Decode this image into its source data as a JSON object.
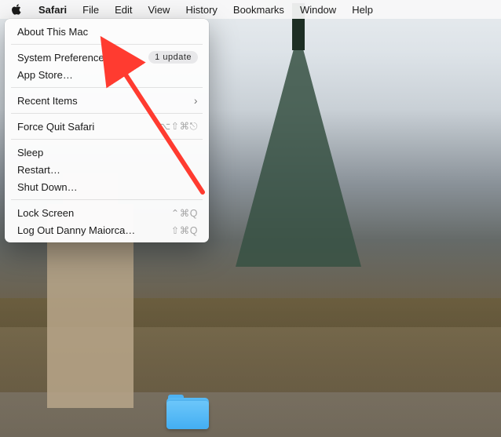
{
  "menubar": {
    "items": [
      {
        "label": "Safari"
      },
      {
        "label": "File"
      },
      {
        "label": "Edit"
      },
      {
        "label": "View"
      },
      {
        "label": "History"
      },
      {
        "label": "Bookmarks"
      },
      {
        "label": "Window"
      },
      {
        "label": "Help"
      }
    ]
  },
  "appleMenu": {
    "about": "About This Mac",
    "sysprefs": "System Preferences…",
    "sysprefs_badge": "1 update",
    "appstore": "App Store…",
    "recent": "Recent Items",
    "forceQuit": "Force Quit Safari",
    "forceQuit_shortcut": "⌥⇧⌘⎋",
    "sleep": "Sleep",
    "restart": "Restart…",
    "shutdown": "Shut Down…",
    "lock": "Lock Screen",
    "lock_shortcut": "⌃⌘Q",
    "logout": "Log Out Danny Maiorca…",
    "logout_shortcut": "⇧⌘Q"
  },
  "annotation": {
    "arrow_color": "#ff3b30"
  }
}
